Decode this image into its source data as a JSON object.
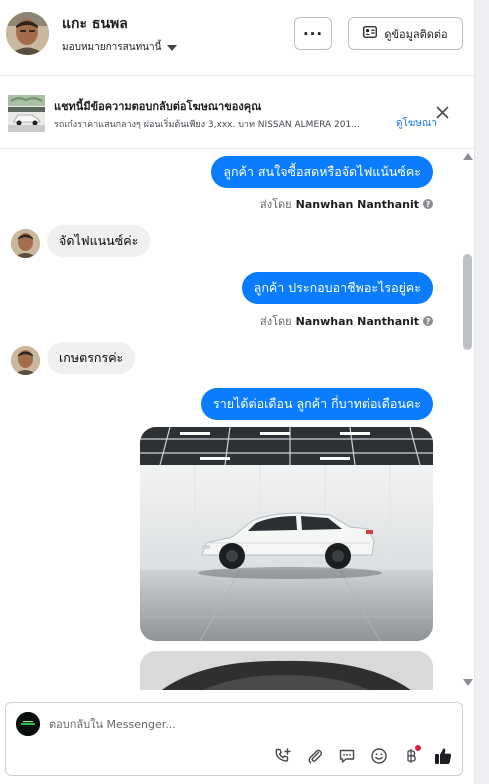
{
  "header": {
    "contact_name": "แกะ ธนพล",
    "assign_label": "มอบหมายการสนทนานี้",
    "more_label": "···",
    "contact_info_label": "ดูข้อมูลติดต่อ"
  },
  "ad_banner": {
    "title": "แชทนี้มีข้อความตอบกลับต่อโฆษณาของคุณ",
    "subtitle": "รถเก๋งราคาแสนกลางๆ ผ่อนเริ่มต้นเพียง 3,xxx. บาท NISSAN ALMERA 201...",
    "view_ad_label": "ดูโฆษณา"
  },
  "messages": [
    {
      "direction": "out",
      "text": "ลูกค้า สนใจซื้อสดหรือจัดไฟแน้นซ์คะ"
    },
    {
      "type": "sender",
      "prefix": "ส่งโดย",
      "name": "Nanwhan Nanthanit"
    },
    {
      "direction": "in",
      "text": "จัดไฟแนนซ์ค่ะ"
    },
    {
      "direction": "out",
      "text": "ลูกค้า ประกอบอาชีพอะไรอยู่คะ"
    },
    {
      "type": "sender",
      "prefix": "ส่งโดย",
      "name": "Nanwhan Nanthanit"
    },
    {
      "direction": "in",
      "text": "เกษตรกรค่ะ"
    },
    {
      "direction": "out",
      "text": "รายได้ต่อเดือน  ลูกค้า กี่บาทต่อเดือนคะ"
    }
  ],
  "composer": {
    "placeholder": "ตอบกลับใน Messenger..."
  },
  "icons": {
    "call": "phone-plus-icon",
    "attach": "paperclip-icon",
    "quick_reply": "chat-bubble-icon",
    "emoji": "smiley-icon",
    "payment": "baht-icon",
    "like": "thumbs-up-icon"
  },
  "colors": {
    "outgoing_bubble": "#0a7cff",
    "incoming_bubble": "#f0f0f0",
    "link": "#1b74e4",
    "like": "#1c1e21",
    "notify_dot": "#e41e3f"
  }
}
